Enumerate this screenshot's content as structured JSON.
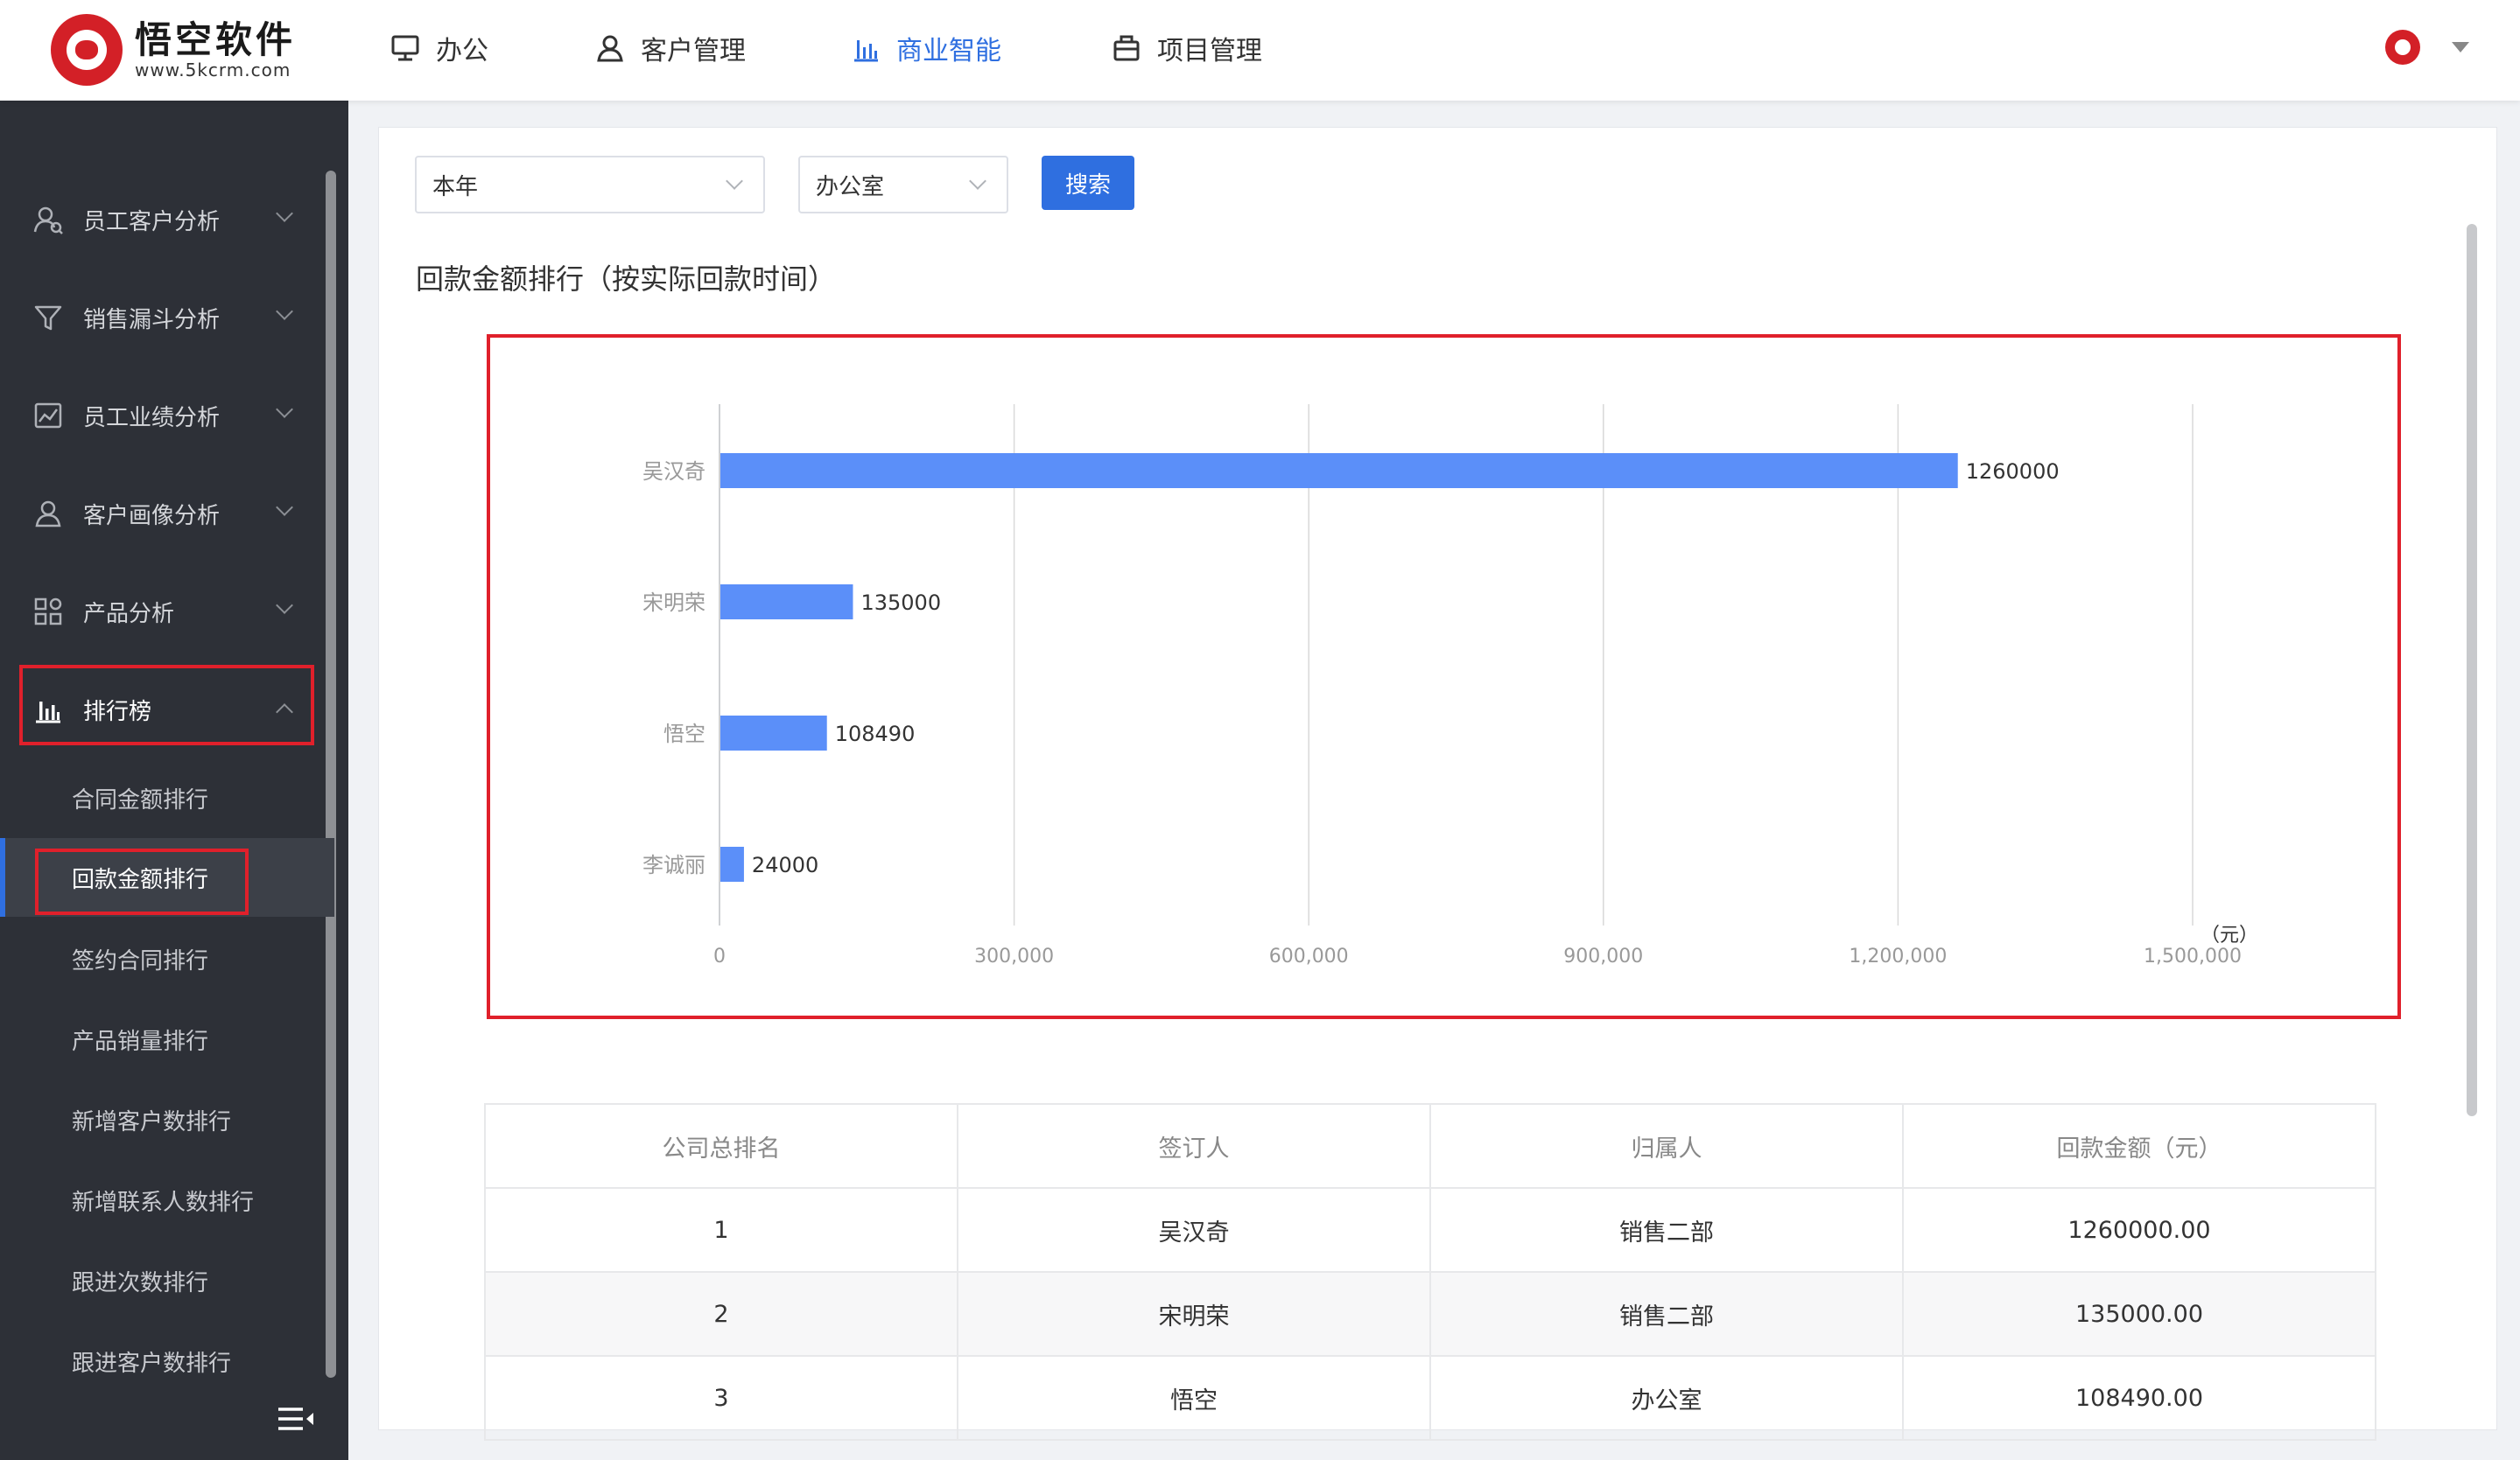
{
  "brand": {
    "name": "悟空软件",
    "url": "www.5kcrm.com"
  },
  "nav": [
    {
      "label": "办公",
      "icon": "monitor-icon"
    },
    {
      "label": "客户管理",
      "icon": "person-icon"
    },
    {
      "label": "商业智能",
      "icon": "bar-chart-icon",
      "active": true
    },
    {
      "label": "项目管理",
      "icon": "briefcase-icon"
    }
  ],
  "sidebar": {
    "items": [
      {
        "label": "员工客户分析",
        "icon": "user-analysis-icon"
      },
      {
        "label": "销售漏斗分析",
        "icon": "funnel-icon"
      },
      {
        "label": "员工业绩分析",
        "icon": "line-chart-icon"
      },
      {
        "label": "客户画像分析",
        "icon": "person-icon"
      },
      {
        "label": "产品分析",
        "icon": "grid-icon"
      },
      {
        "label": "排行榜",
        "icon": "bar-chart-icon",
        "open": true
      }
    ],
    "subitems": [
      "合同金额排行",
      "回款金额排行",
      "签约合同排行",
      "产品销量排行",
      "新增客户数排行",
      "新增联系人数排行",
      "跟进次数排行",
      "跟进客户数排行"
    ],
    "active_subitem": "回款金额排行"
  },
  "filters": {
    "period": "本年",
    "department": "办公室",
    "search_label": "搜索"
  },
  "chart_title": "回款金额排行（按实际回款时间）",
  "chart_data": {
    "type": "bar",
    "orientation": "horizontal",
    "categories": [
      "吴汉奇",
      "宋明荣",
      "悟空",
      "李诚丽"
    ],
    "values": [
      1260000,
      135000,
      108490,
      24000
    ],
    "data_labels": [
      "1260000",
      "135000",
      "108490",
      "24000"
    ],
    "xlim": [
      0,
      1500000
    ],
    "xticks": [
      "0",
      "300,000",
      "600,000",
      "900,000",
      "1,200,000",
      "1,500,000"
    ],
    "unit_label": "（元）",
    "bar_color": "#5b8ff9",
    "grid": true
  },
  "table": {
    "headers": [
      "公司总排名",
      "签订人",
      "归属人",
      "回款金额（元）"
    ],
    "rows": [
      [
        "1",
        "吴汉奇",
        "销售二部",
        "1260000.00"
      ],
      [
        "2",
        "宋明荣",
        "销售二部",
        "135000.00"
      ],
      [
        "3",
        "悟空",
        "办公室",
        "108490.00"
      ]
    ]
  },
  "colors": {
    "accent": "#2f6fe0",
    "highlight_border": "#e0202b",
    "sidebar_bg": "#2d3037"
  }
}
